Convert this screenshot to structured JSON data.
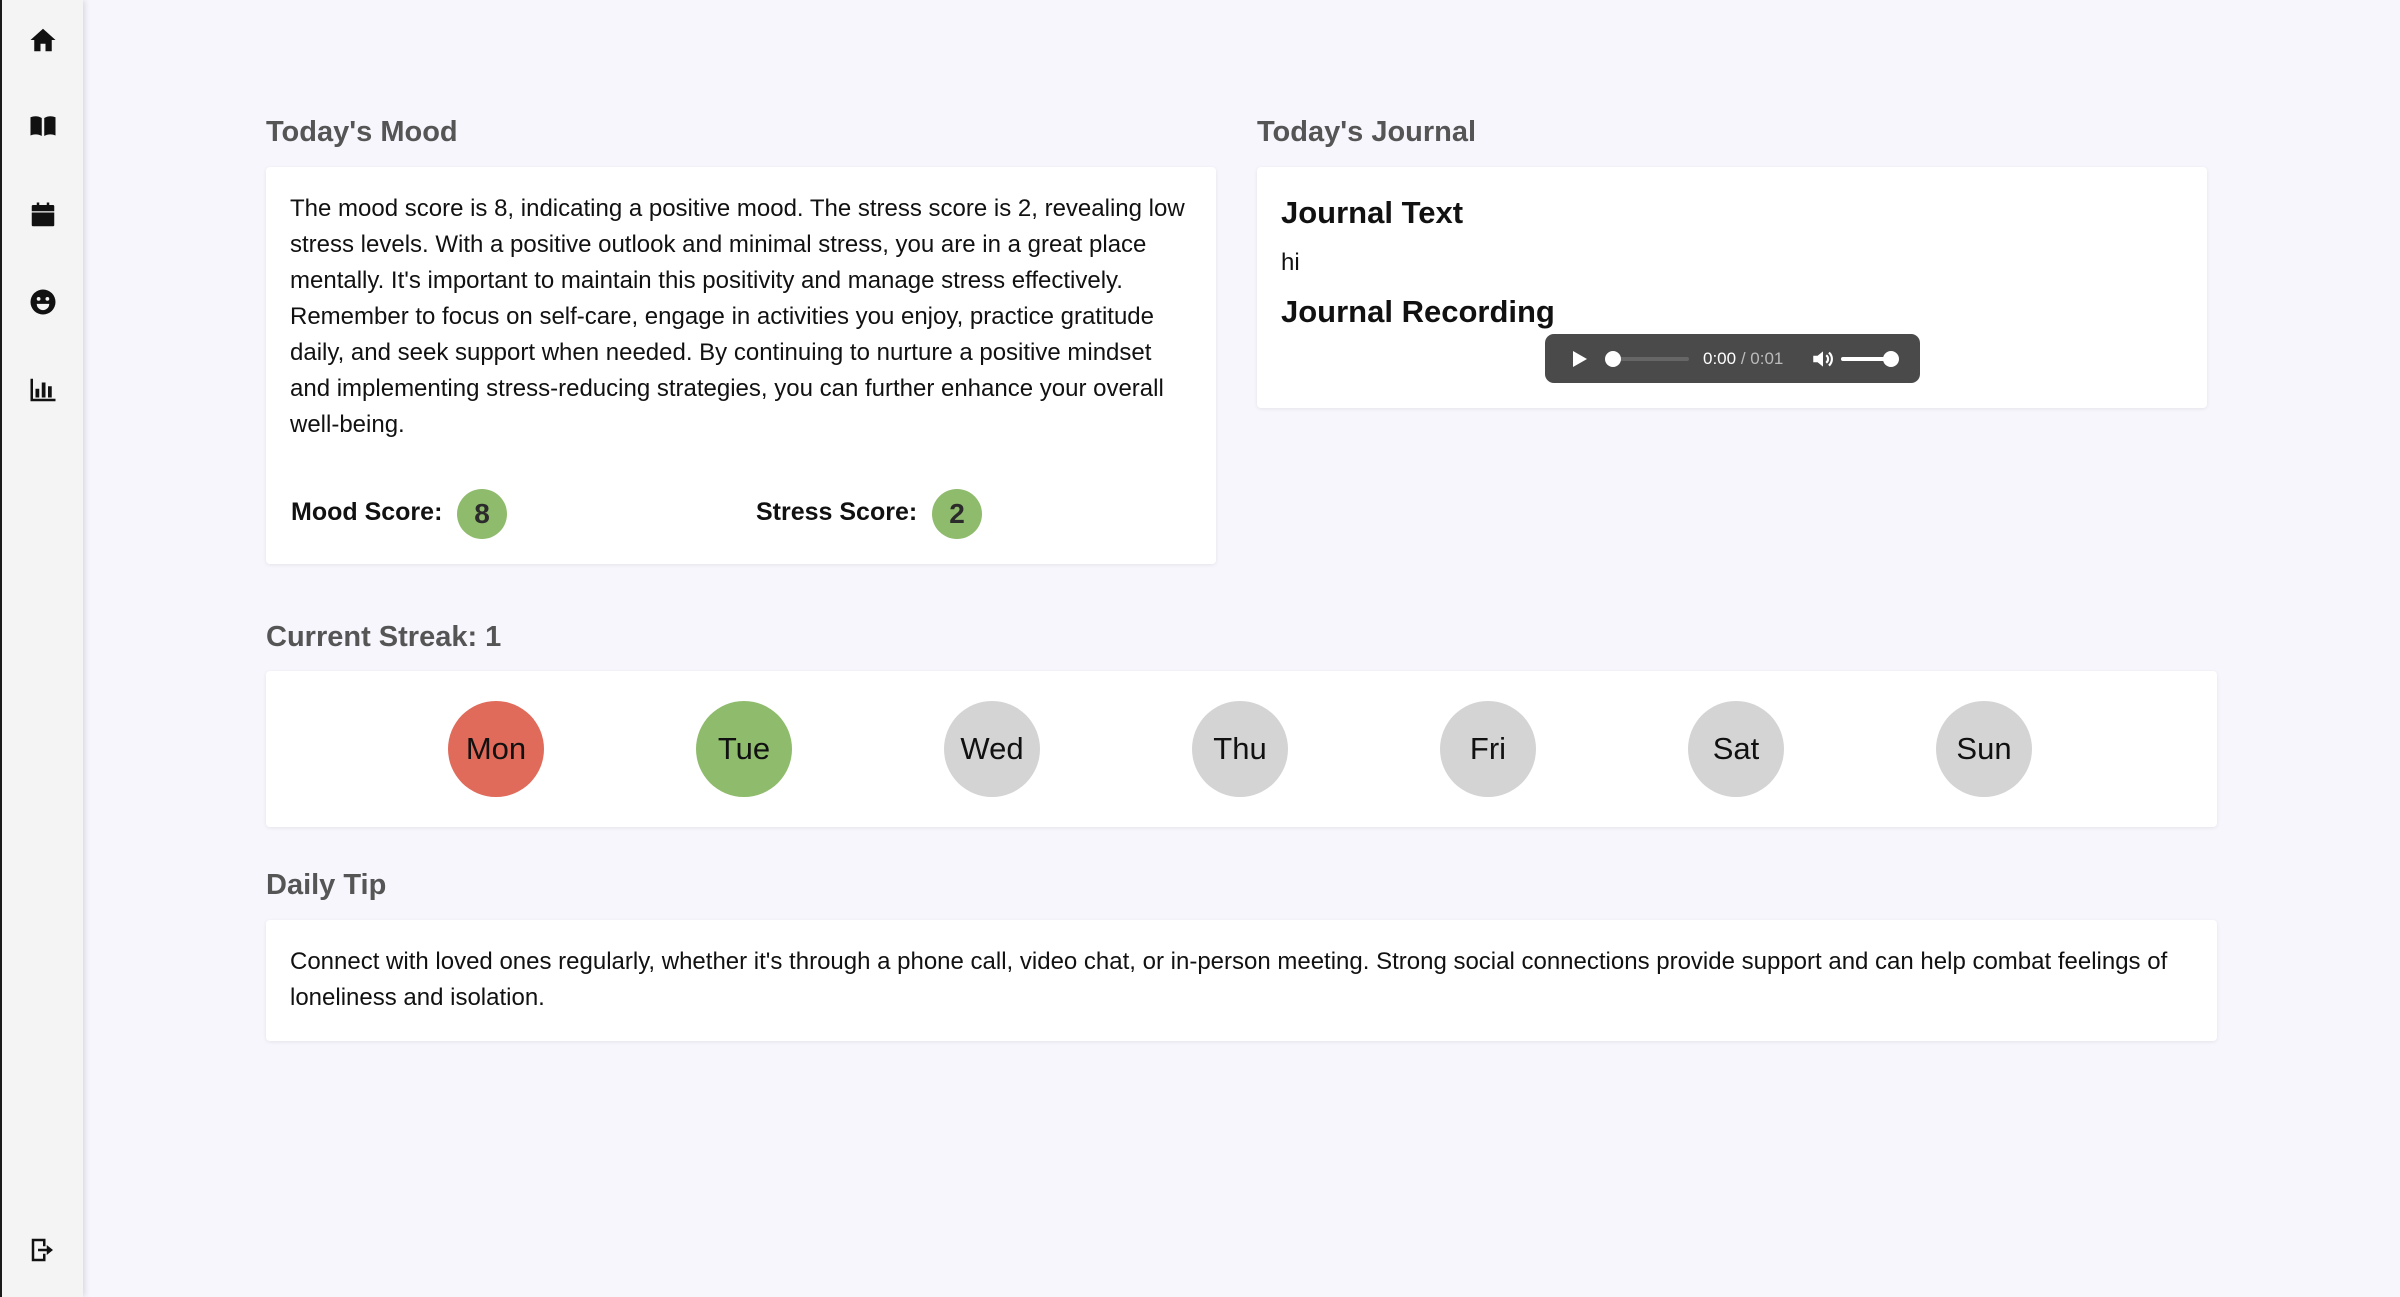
{
  "sidebar": {
    "items": [
      {
        "icon": "home-icon"
      },
      {
        "icon": "book-icon"
      },
      {
        "icon": "calendar-icon"
      },
      {
        "icon": "smiley-icon"
      },
      {
        "icon": "bar-chart-icon"
      }
    ],
    "logout_icon": "logout-icon"
  },
  "mood": {
    "title": "Today's Mood",
    "description": "The mood score is 8, indicating a positive mood. The stress score is 2, revealing low stress levels. With a positive outlook and minimal stress, you are in a great place mentally. It's important to maintain this positivity and manage stress effectively. Remember to focus on self-care, engage in activities you enjoy, practice gratitude daily, and seek support when needed. By continuing to nurture a positive mindset and implementing stress-reducing strategies, you can further enhance your overall well-being.",
    "mood_label": "Mood Score:",
    "mood_value": "8",
    "stress_label": "Stress Score:",
    "stress_value": "2",
    "badge_color": "#8fbb6c"
  },
  "journal": {
    "title": "Today's Journal",
    "text_heading": "Journal Text",
    "text": "hi",
    "recording_heading": "Journal Recording",
    "audio": {
      "current_time": "0:00",
      "separator": "/",
      "duration": "0:01"
    }
  },
  "streak": {
    "title": "Current Streak: 1",
    "days": [
      {
        "label": "Mon",
        "color": "#e06b5b"
      },
      {
        "label": "Tue",
        "color": "#8fbb6c"
      },
      {
        "label": "Wed",
        "color": "#d4d4d4"
      },
      {
        "label": "Thu",
        "color": "#d4d4d4"
      },
      {
        "label": "Fri",
        "color": "#d4d4d4"
      },
      {
        "label": "Sat",
        "color": "#d4d4d4"
      },
      {
        "label": "Sun",
        "color": "#d4d4d4"
      }
    ]
  },
  "tip": {
    "title": "Daily Tip",
    "text": "Connect with loved ones regularly, whether it's through a phone call, video chat, or in-person meeting. Strong social connections provide support and can help combat feelings of loneliness and isolation."
  }
}
